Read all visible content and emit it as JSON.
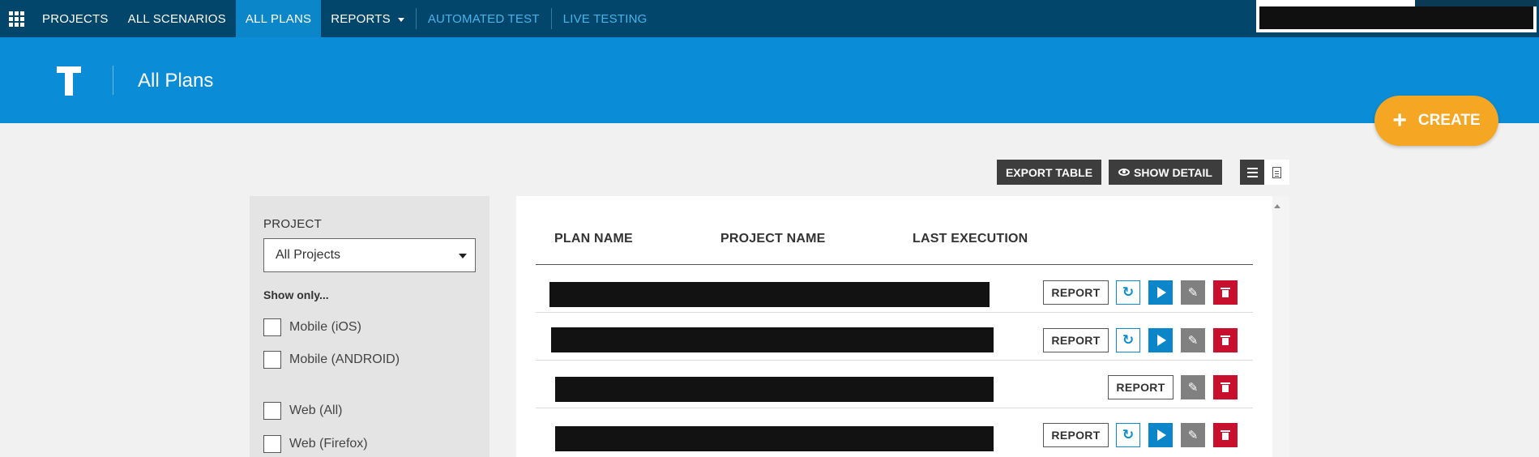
{
  "nav": {
    "items": [
      "PROJECTS",
      "ALL SCENARIOS",
      "ALL PLANS",
      "REPORTS"
    ],
    "automated_test": "AUTOMATED TEST",
    "live_testing": "LIVE TESTING"
  },
  "header": {
    "title": "All Plans"
  },
  "create": {
    "label": "CREATE",
    "color": "#f5a623"
  },
  "toolbar": {
    "export_label": "EXPORT TABLE",
    "detail_label": "SHOW DETAIL"
  },
  "filters": {
    "project_label": "PROJECT",
    "project_value": "All Projects",
    "show_only_label": "Show only...",
    "options": [
      "Mobile (iOS)",
      "Mobile (ANDROID)",
      "Web (All)",
      "Web (Firefox)"
    ]
  },
  "table": {
    "columns": [
      "PLAN NAME",
      "PROJECT NAME",
      "LAST EXECUTION"
    ],
    "report_label": "REPORT"
  },
  "colors": {
    "nav_bg": "#02466b",
    "header_bg": "#0a8dd6",
    "delete": "#c8102e",
    "play": "#0a86c9"
  }
}
